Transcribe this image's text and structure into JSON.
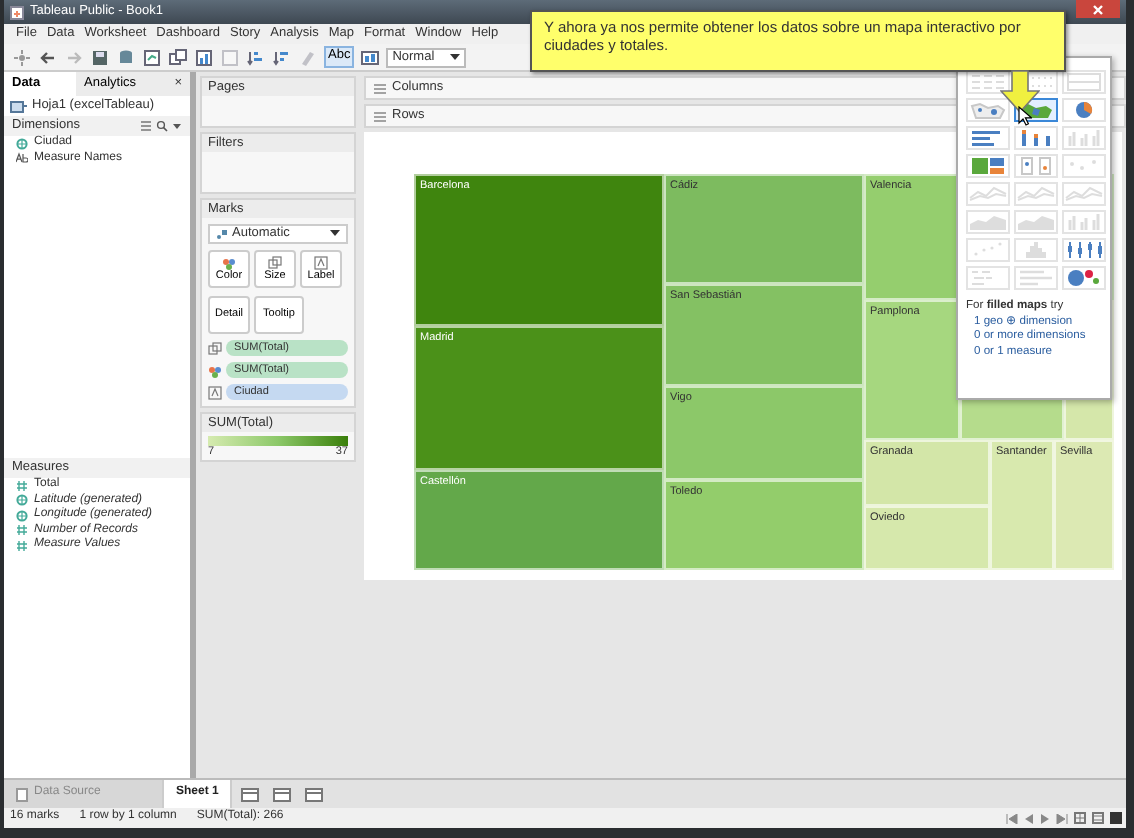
{
  "window": {
    "title": "Tableau Public - Book1"
  },
  "menu": [
    "File",
    "Data",
    "Worksheet",
    "Dashboard",
    "Story",
    "Analysis",
    "Map",
    "Format",
    "Window",
    "Help"
  ],
  "toolbar": {
    "buttons": [
      {
        "kind": "logo",
        "disabled": false
      },
      {
        "kind": "back",
        "disabled": false
      },
      {
        "kind": "forward",
        "disabled": true
      },
      {
        "kind": "save",
        "disabled": false
      },
      {
        "kind": "datasource",
        "disabled": false
      },
      {
        "kind": "newsheet",
        "disabled": false
      },
      {
        "kind": "duplicate",
        "disabled": false
      },
      {
        "kind": "chart",
        "disabled": false
      },
      {
        "kind": "clear",
        "disabled": true
      },
      {
        "kind": "sortasc",
        "disabled": false
      },
      {
        "kind": "sortdesc",
        "disabled": false
      },
      {
        "kind": "highlight",
        "disabled": true
      }
    ],
    "label_button": {
      "text": "Abc",
      "selected": true
    },
    "fit": {
      "value": "Normal"
    }
  },
  "data_pane": {
    "tabs": [
      {
        "label": "Data",
        "selected": true
      },
      {
        "label": "Analytics",
        "selected": false
      }
    ],
    "close": "×",
    "source": "Hoja1 (excelTableau)",
    "dimensions": {
      "title": "Dimensions",
      "items": [
        {
          "name": "Ciudad",
          "kind": "geo",
          "generated": false
        },
        {
          "name": "Measure Names",
          "kind": "text",
          "generated": false
        }
      ]
    },
    "measures": {
      "title": "Measures",
      "items": [
        {
          "name": "Total",
          "kind": "number",
          "generated": false
        },
        {
          "name": "Latitude (generated)",
          "kind": "geo",
          "generated": true
        },
        {
          "name": "Longitude (generated)",
          "kind": "geo",
          "generated": true
        },
        {
          "name": "Number of Records",
          "kind": "number",
          "generated": true
        },
        {
          "name": "Measure Values",
          "kind": "number",
          "generated": true
        }
      ]
    }
  },
  "shelves": {
    "pages": "Pages",
    "filters": "Filters",
    "columns": "Columns",
    "rows": "Rows"
  },
  "marks": {
    "title": "Marks",
    "type": "Automatic",
    "buttons": [
      {
        "label": "Color",
        "kind": "color"
      },
      {
        "label": "Size",
        "kind": "size"
      },
      {
        "label": "Label",
        "kind": "label"
      },
      {
        "label": "Detail",
        "kind": "detail"
      },
      {
        "label": "Tooltip",
        "kind": "tooltip"
      }
    ],
    "pills": [
      {
        "label": "SUM(Total)",
        "kind": "size",
        "color": "#b9e2c6"
      },
      {
        "label": "SUM(Total)",
        "kind": "color",
        "color": "#b9e2c6"
      },
      {
        "label": "Ciudad",
        "kind": "label",
        "color": "#c5d9f1"
      }
    ]
  },
  "legend": {
    "title": "SUM(Total)",
    "min": "7",
    "max": "37"
  },
  "treemap": [
    {
      "label": "Barcelona",
      "color": "#3f850e"
    },
    {
      "label": "Madrid",
      "color": "#4b9119"
    },
    {
      "label": "Castellón",
      "color": "#63a84a"
    },
    {
      "label": "Cádiz",
      "color": "#7dbb5f"
    },
    {
      "label": "San Sebastián",
      "color": "#84c163"
    },
    {
      "label": "Vigo",
      "color": "#8cc869"
    },
    {
      "label": "Toledo",
      "color": "#93cd6b"
    },
    {
      "label": "Valencia",
      "color": "#95ce6e"
    },
    {
      "label": "Pamplona",
      "color": "#a6d77f"
    },
    {
      "color": "#b5dc8c"
    },
    {
      "color": "#d5e7aa"
    },
    {
      "label": "Granada",
      "color": "#d3e6a8"
    },
    {
      "label": "Oviedo",
      "color": "#d6e8ac"
    },
    {
      "label": "Santander",
      "color": "#d8e9ae"
    },
    {
      "label": "Sevilla",
      "color": "#dce9b3"
    }
  ],
  "show_me": {
    "charts": [
      {
        "kind": "table",
        "disabled": true,
        "selected": false
      },
      {
        "kind": "heatmap",
        "disabled": true,
        "selected": false
      },
      {
        "kind": "highlight",
        "disabled": true,
        "selected": false
      },
      {
        "kind": "symbolmap",
        "disabled": false,
        "selected": false
      },
      {
        "kind": "filledmap",
        "disabled": false,
        "selected": true
      },
      {
        "kind": "pie",
        "disabled": false,
        "selected": false
      },
      {
        "kind": "hbar",
        "disabled": false,
        "selected": false
      },
      {
        "kind": "stackedbar",
        "disabled": false,
        "selected": false
      },
      {
        "kind": "sidebar",
        "disabled": true,
        "selected": false
      },
      {
        "kind": "treemap",
        "disabled": false,
        "selected": false
      },
      {
        "kind": "circles",
        "disabled": false,
        "selected": false
      },
      {
        "kind": "sidecircles",
        "disabled": true,
        "selected": false
      },
      {
        "kind": "line",
        "disabled": true,
        "selected": false
      },
      {
        "kind": "line",
        "disabled": true,
        "selected": false
      },
      {
        "kind": "line",
        "disabled": true,
        "selected": false
      },
      {
        "kind": "area",
        "disabled": true,
        "selected": false
      },
      {
        "kind": "area",
        "disabled": true,
        "selected": false
      },
      {
        "kind": "sidebar",
        "disabled": true,
        "selected": false
      },
      {
        "kind": "scatter",
        "disabled": true,
        "selected": false
      },
      {
        "kind": "histogram",
        "disabled": true,
        "selected": false
      },
      {
        "kind": "boxplot",
        "disabled": false,
        "selected": false
      },
      {
        "kind": "gantt",
        "disabled": true,
        "selected": false
      },
      {
        "kind": "bullet",
        "disabled": true,
        "selected": false
      },
      {
        "kind": "bubbles",
        "disabled": false,
        "selected": false
      }
    ],
    "hint": "For **filled maps** try",
    "requirements": [
      "1 geo ⊕ dimension",
      "0 or more dimensions",
      "0 or 1 measure"
    ]
  },
  "callout": {
    "text": "Y ahora ya nos permite obtener los datos sobre un mapa interactivo por ciudades y totales."
  },
  "sheet_tabs": [
    {
      "label": "Data Source",
      "kind": "datasource",
      "selected": false
    },
    {
      "label": "Sheet 1",
      "kind": "sheet",
      "selected": true
    }
  ],
  "status_bar": [
    "16 marks",
    "1 row by 1 column",
    "SUM(Total): 266"
  ]
}
